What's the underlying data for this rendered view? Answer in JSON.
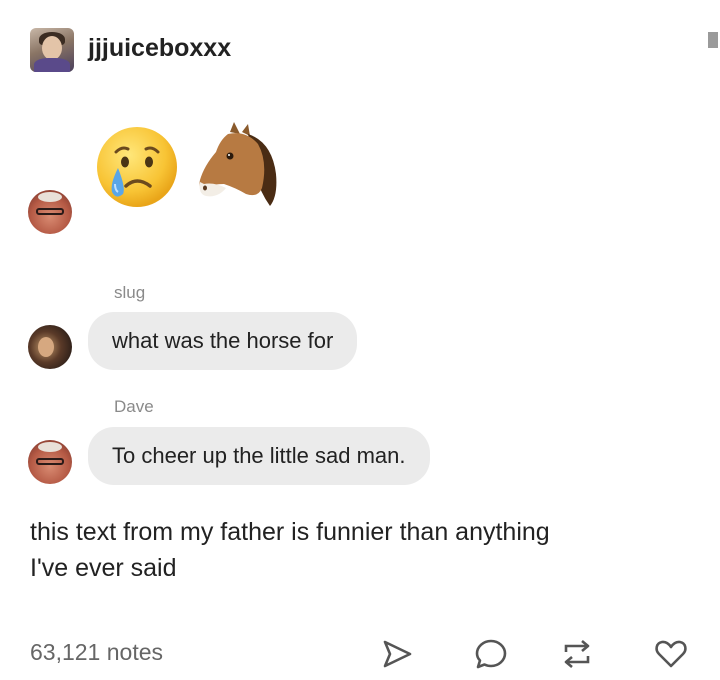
{
  "post": {
    "username": "jjjuiceboxxx",
    "emoji_message": [
      "crying-face",
      "horse-face"
    ],
    "messages": [
      {
        "sender": "slug",
        "text": "what was the horse for"
      },
      {
        "sender": "Dave",
        "text": "To cheer up the little sad man."
      }
    ],
    "caption_line1": "this text from my father is funnier than anything",
    "caption_line2": "I've ever said"
  },
  "footer": {
    "notes": "63,121 notes",
    "actions": [
      "share-icon",
      "reply-icon",
      "reblog-icon",
      "like-icon"
    ]
  },
  "colors": {
    "bubble": "#ebebeb",
    "text": "#222222",
    "muted": "#8a8a8a",
    "icon": "#555555"
  }
}
